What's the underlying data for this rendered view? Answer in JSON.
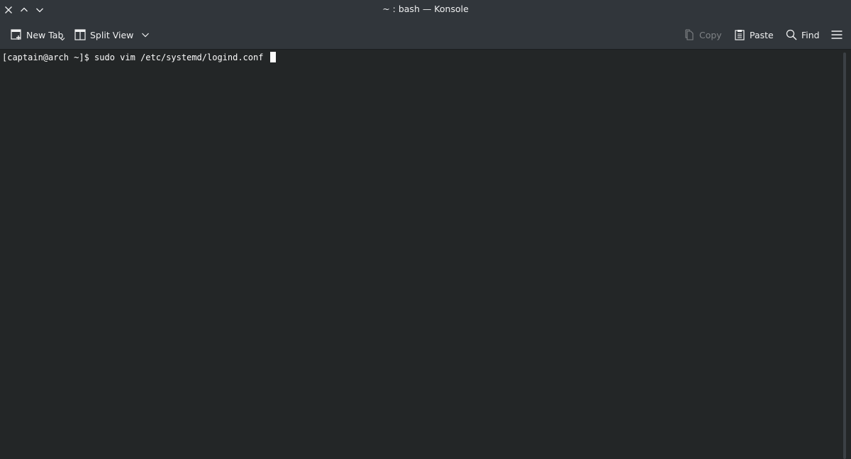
{
  "window": {
    "title": "~ : bash — Konsole",
    "buttons": [
      "close-icon",
      "maximize-icon",
      "minimize-icon"
    ]
  },
  "toolbar": {
    "new_tab_label": "New Tab",
    "split_view_label": "Split View",
    "copy_label": "Copy",
    "paste_label": "Paste",
    "find_label": "Find",
    "copy_enabled": false
  },
  "terminal": {
    "prompt": "[captain@arch ~]$ ",
    "command": "sudo vim /etc/systemd/logind.conf "
  },
  "colors": {
    "background": "#232627",
    "chrome": "#31363b",
    "text": "#fcfcfc"
  }
}
